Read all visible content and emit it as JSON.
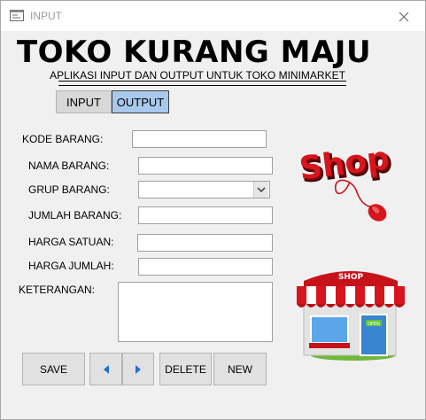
{
  "window": {
    "title": "INPUT"
  },
  "header": {
    "title": "TOKO KURANG MAJU",
    "subtitle": "APLIKASI INPUT DAN OUTPUT UNTUK TOKO MINIMARKET",
    "separator": "=============================================="
  },
  "tabs": [
    {
      "label": "INPUT",
      "active": false
    },
    {
      "label": "OUTPUT",
      "active": true
    }
  ],
  "form": {
    "kode_barang": {
      "label": "KODE BARANG:",
      "value": ""
    },
    "nama_barang": {
      "label": "NAMA BARANG:",
      "value": ""
    },
    "grup_barang": {
      "label": "GRUP BARANG:",
      "value": ""
    },
    "jumlah_barang": {
      "label": "JUMLAH BARANG:",
      "value": ""
    },
    "harga_satuan": {
      "label": "HARGA SATUAN:",
      "value": ""
    },
    "harga_jumlah": {
      "label": "HARGA JUMLAH:",
      "value": ""
    },
    "keterangan": {
      "label": "KETERANGAN:",
      "value": ""
    }
  },
  "buttons": {
    "save": "SAVE",
    "delete": "DELETE",
    "new": "NEW"
  },
  "images": {
    "shop_logo_text": "Shop",
    "shop_store_sign": "SHOP",
    "shop_door_sign": "OPEN"
  },
  "icons": {
    "app": "form-icon",
    "close": "close-icon",
    "prev": "triangle-left-icon",
    "next": "triangle-right-icon",
    "dropdown": "chevron-down-icon"
  },
  "colors": {
    "tab_active": "#a8c8ec",
    "nav_arrow": "#1f6fd1",
    "shop_red": "#d8141c"
  }
}
